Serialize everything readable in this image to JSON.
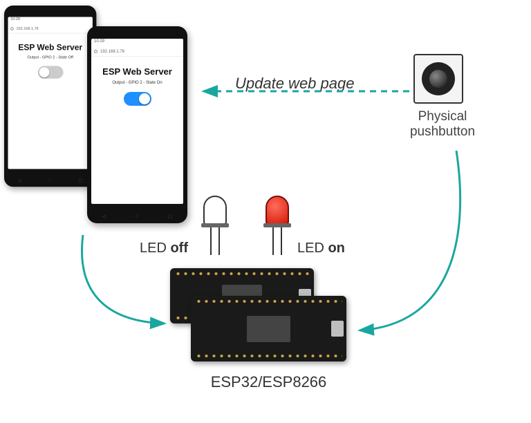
{
  "phone1": {
    "time": "10:28",
    "url": "192.168.1.76",
    "title": "ESP Web Server",
    "output_label": "Output - GPIO 2 - State Off",
    "toggle_state": "off"
  },
  "phone2": {
    "time": "10:29",
    "url": "192.168.1.76",
    "title": "ESP Web Server",
    "output_label": "Output - GPIO 2 - State On",
    "toggle_state": "on"
  },
  "labels": {
    "update": "Update web page",
    "pushbutton_l1": "Physical",
    "pushbutton_l2": "pushbutton",
    "led_off_pre": "LED ",
    "led_off_b": "off",
    "led_on_pre": "LED ",
    "led_on_b": "on",
    "board": "ESP32/ESP8266"
  },
  "colors": {
    "teal": "#1aa6a0"
  }
}
